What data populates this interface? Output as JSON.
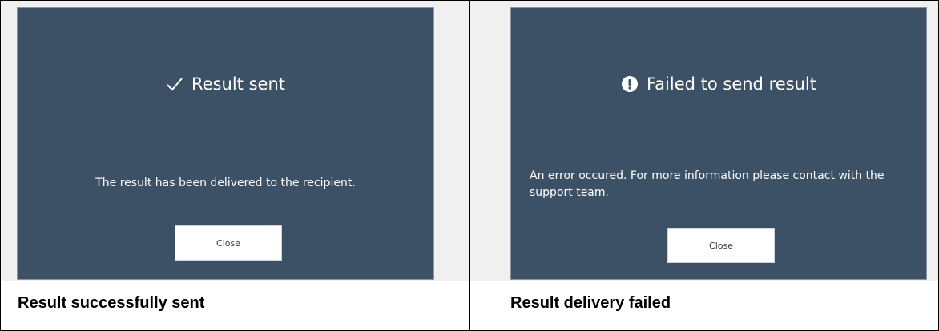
{
  "success_dialog": {
    "title": "Result sent",
    "icon": "checkmark-icon",
    "message": "The result has been delivered to the recipient.",
    "close_label": "Close",
    "caption": "Result successfully sent"
  },
  "failure_dialog": {
    "title": "Failed to send result",
    "icon": "exclamation-circle-icon",
    "message": "An error occured. For more information please contact with the support team.",
    "close_label": "Close",
    "caption": "Result delivery failed"
  },
  "colors": {
    "dialog_background": "#3d5166",
    "panel_background": "#f0f0f0",
    "text": "#ffffff",
    "button_background": "#ffffff"
  }
}
